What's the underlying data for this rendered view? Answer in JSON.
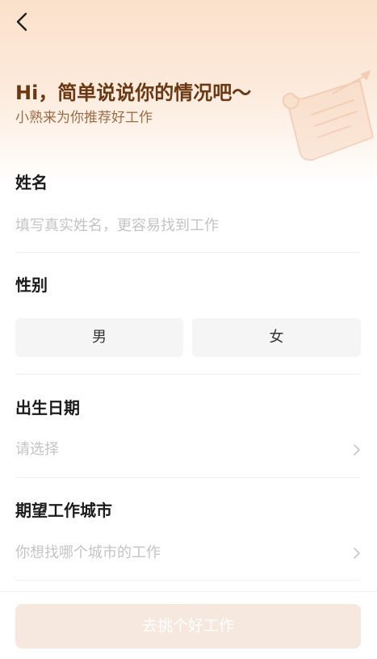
{
  "header": {
    "back_icon": "chevron-left-icon"
  },
  "intro": {
    "title": "Hi，简单说说你的情况吧～",
    "subtitle": "小熟来为你推荐好工作",
    "decoration_icon": "scroll-pen-illustration"
  },
  "form": {
    "name": {
      "label": "姓名",
      "placeholder": "填写真实姓名，更容易找到工作",
      "value": ""
    },
    "gender": {
      "label": "性别",
      "options": [
        "男",
        "女"
      ],
      "selected": null
    },
    "birth_date": {
      "label": "出生日期",
      "placeholder": "请选择",
      "icon": "chevron-right-icon"
    },
    "city": {
      "label": "期望工作城市",
      "placeholder": "你想找哪个城市的工作",
      "icon": "chevron-right-icon"
    }
  },
  "submit": {
    "label": "去挑个好工作",
    "enabled": false
  },
  "colors": {
    "title": "#6a3812",
    "subtitle": "#9c6c45",
    "placeholder": "#c4c4c4",
    "option_bg": "#f5f5f5",
    "submit_bg_disabled": "#f6e7df",
    "hero_gradient_top": "#fbe1cb"
  }
}
